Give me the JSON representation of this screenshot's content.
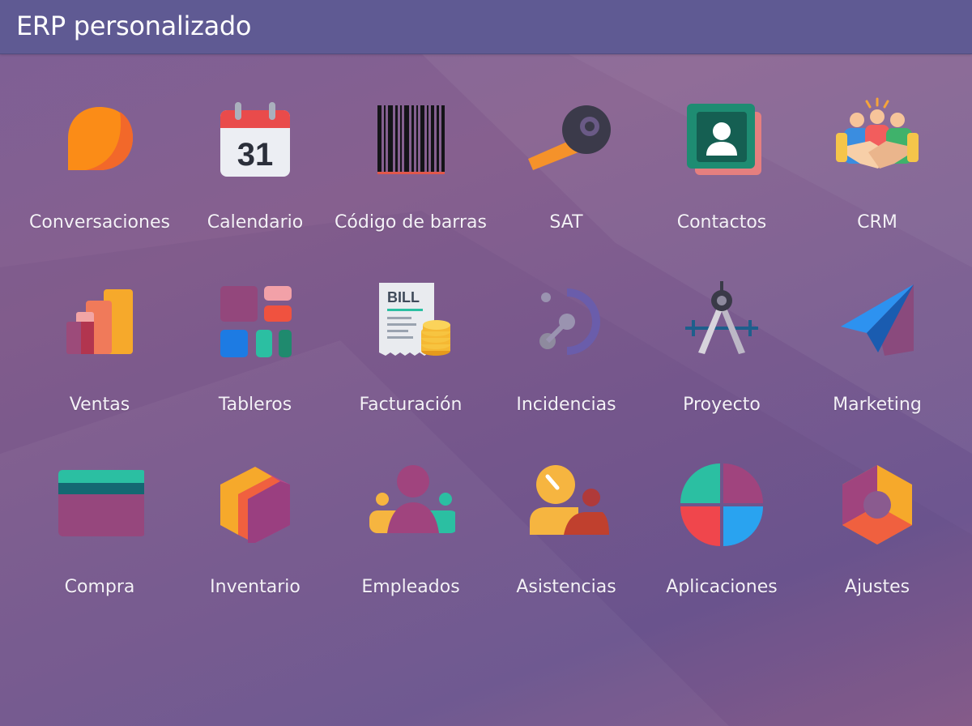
{
  "header": {
    "title": "ERP personalizado"
  },
  "apps": [
    {
      "label": "Conversaciones",
      "icon": "chat-bubble-icon"
    },
    {
      "label": "Calendario",
      "icon": "calendar-icon",
      "badge": "31"
    },
    {
      "label": "Código de barras",
      "icon": "barcode-icon"
    },
    {
      "label": "SAT",
      "icon": "wrench-icon"
    },
    {
      "label": "Contactos",
      "icon": "contact-card-icon"
    },
    {
      "label": "CRM",
      "icon": "handshake-icon"
    },
    {
      "label": "Ventas",
      "icon": "bar-chart-icon"
    },
    {
      "label": "Tableros",
      "icon": "dashboard-tiles-icon"
    },
    {
      "label": "Facturación",
      "icon": "bill-icon",
      "badge": "BILL"
    },
    {
      "label": "Incidencias",
      "icon": "helpdesk-icon"
    },
    {
      "label": "Proyecto",
      "icon": "compass-icon"
    },
    {
      "label": "Marketing",
      "icon": "paper-plane-icon"
    },
    {
      "label": "Compra",
      "icon": "credit-card-icon"
    },
    {
      "label": "Inventario",
      "icon": "box-icon"
    },
    {
      "label": "Empleados",
      "icon": "people-icon"
    },
    {
      "label": "Asistencias",
      "icon": "attendance-icon"
    },
    {
      "label": "Aplicaciones",
      "icon": "apps-quadrant-icon"
    },
    {
      "label": "Ajustes",
      "icon": "settings-hexagon-icon"
    }
  ],
  "colors": {
    "header_bg": "#5f5a93",
    "background": "#7d5f96"
  }
}
